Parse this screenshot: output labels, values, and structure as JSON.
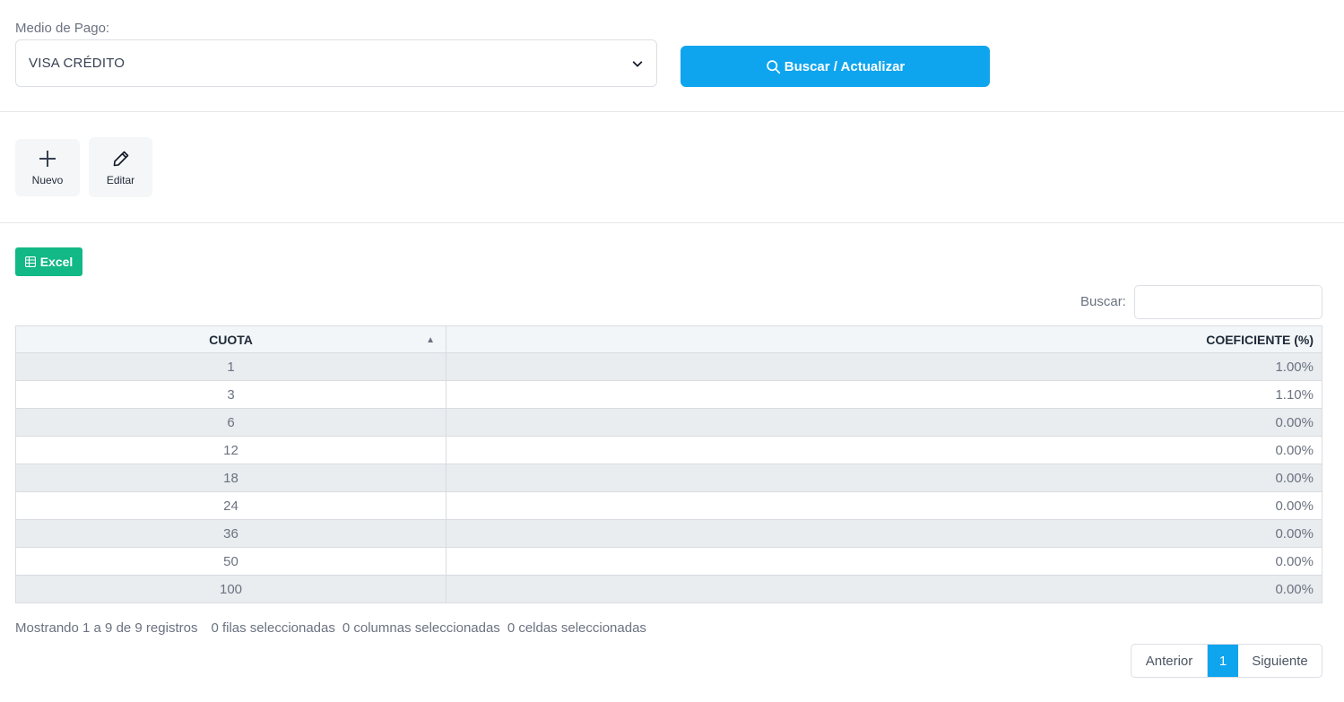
{
  "filter": {
    "label": "Medio de Pago:",
    "selected": "VISA CRÉDITO",
    "search_button": "Buscar / Actualizar"
  },
  "toolbar": {
    "new_label": "Nuevo",
    "edit_label": "Editar",
    "excel_label": "Excel"
  },
  "table_search": {
    "label": "Buscar:",
    "value": ""
  },
  "table": {
    "headers": [
      "CUOTA",
      "COEFICIENTE (%)"
    ],
    "rows": [
      [
        "1",
        "1.00%"
      ],
      [
        "3",
        "1.10%"
      ],
      [
        "6",
        "0.00%"
      ],
      [
        "12",
        "0.00%"
      ],
      [
        "18",
        "0.00%"
      ],
      [
        "24",
        "0.00%"
      ],
      [
        "36",
        "0.00%"
      ],
      [
        "50",
        "0.00%"
      ],
      [
        "100",
        "0.00%"
      ]
    ]
  },
  "info": {
    "records": "Mostrando 1 a 9 de 9 registros",
    "rows_selected": "0 filas seleccionadas",
    "cols_selected": "0 columnas seleccionadas",
    "cells_selected": "0 celdas seleccionadas"
  },
  "pagination": {
    "prev": "Anterior",
    "current": "1",
    "next": "Siguiente"
  },
  "colors": {
    "primary": "#0ea5ee",
    "excel": "#12b886"
  }
}
